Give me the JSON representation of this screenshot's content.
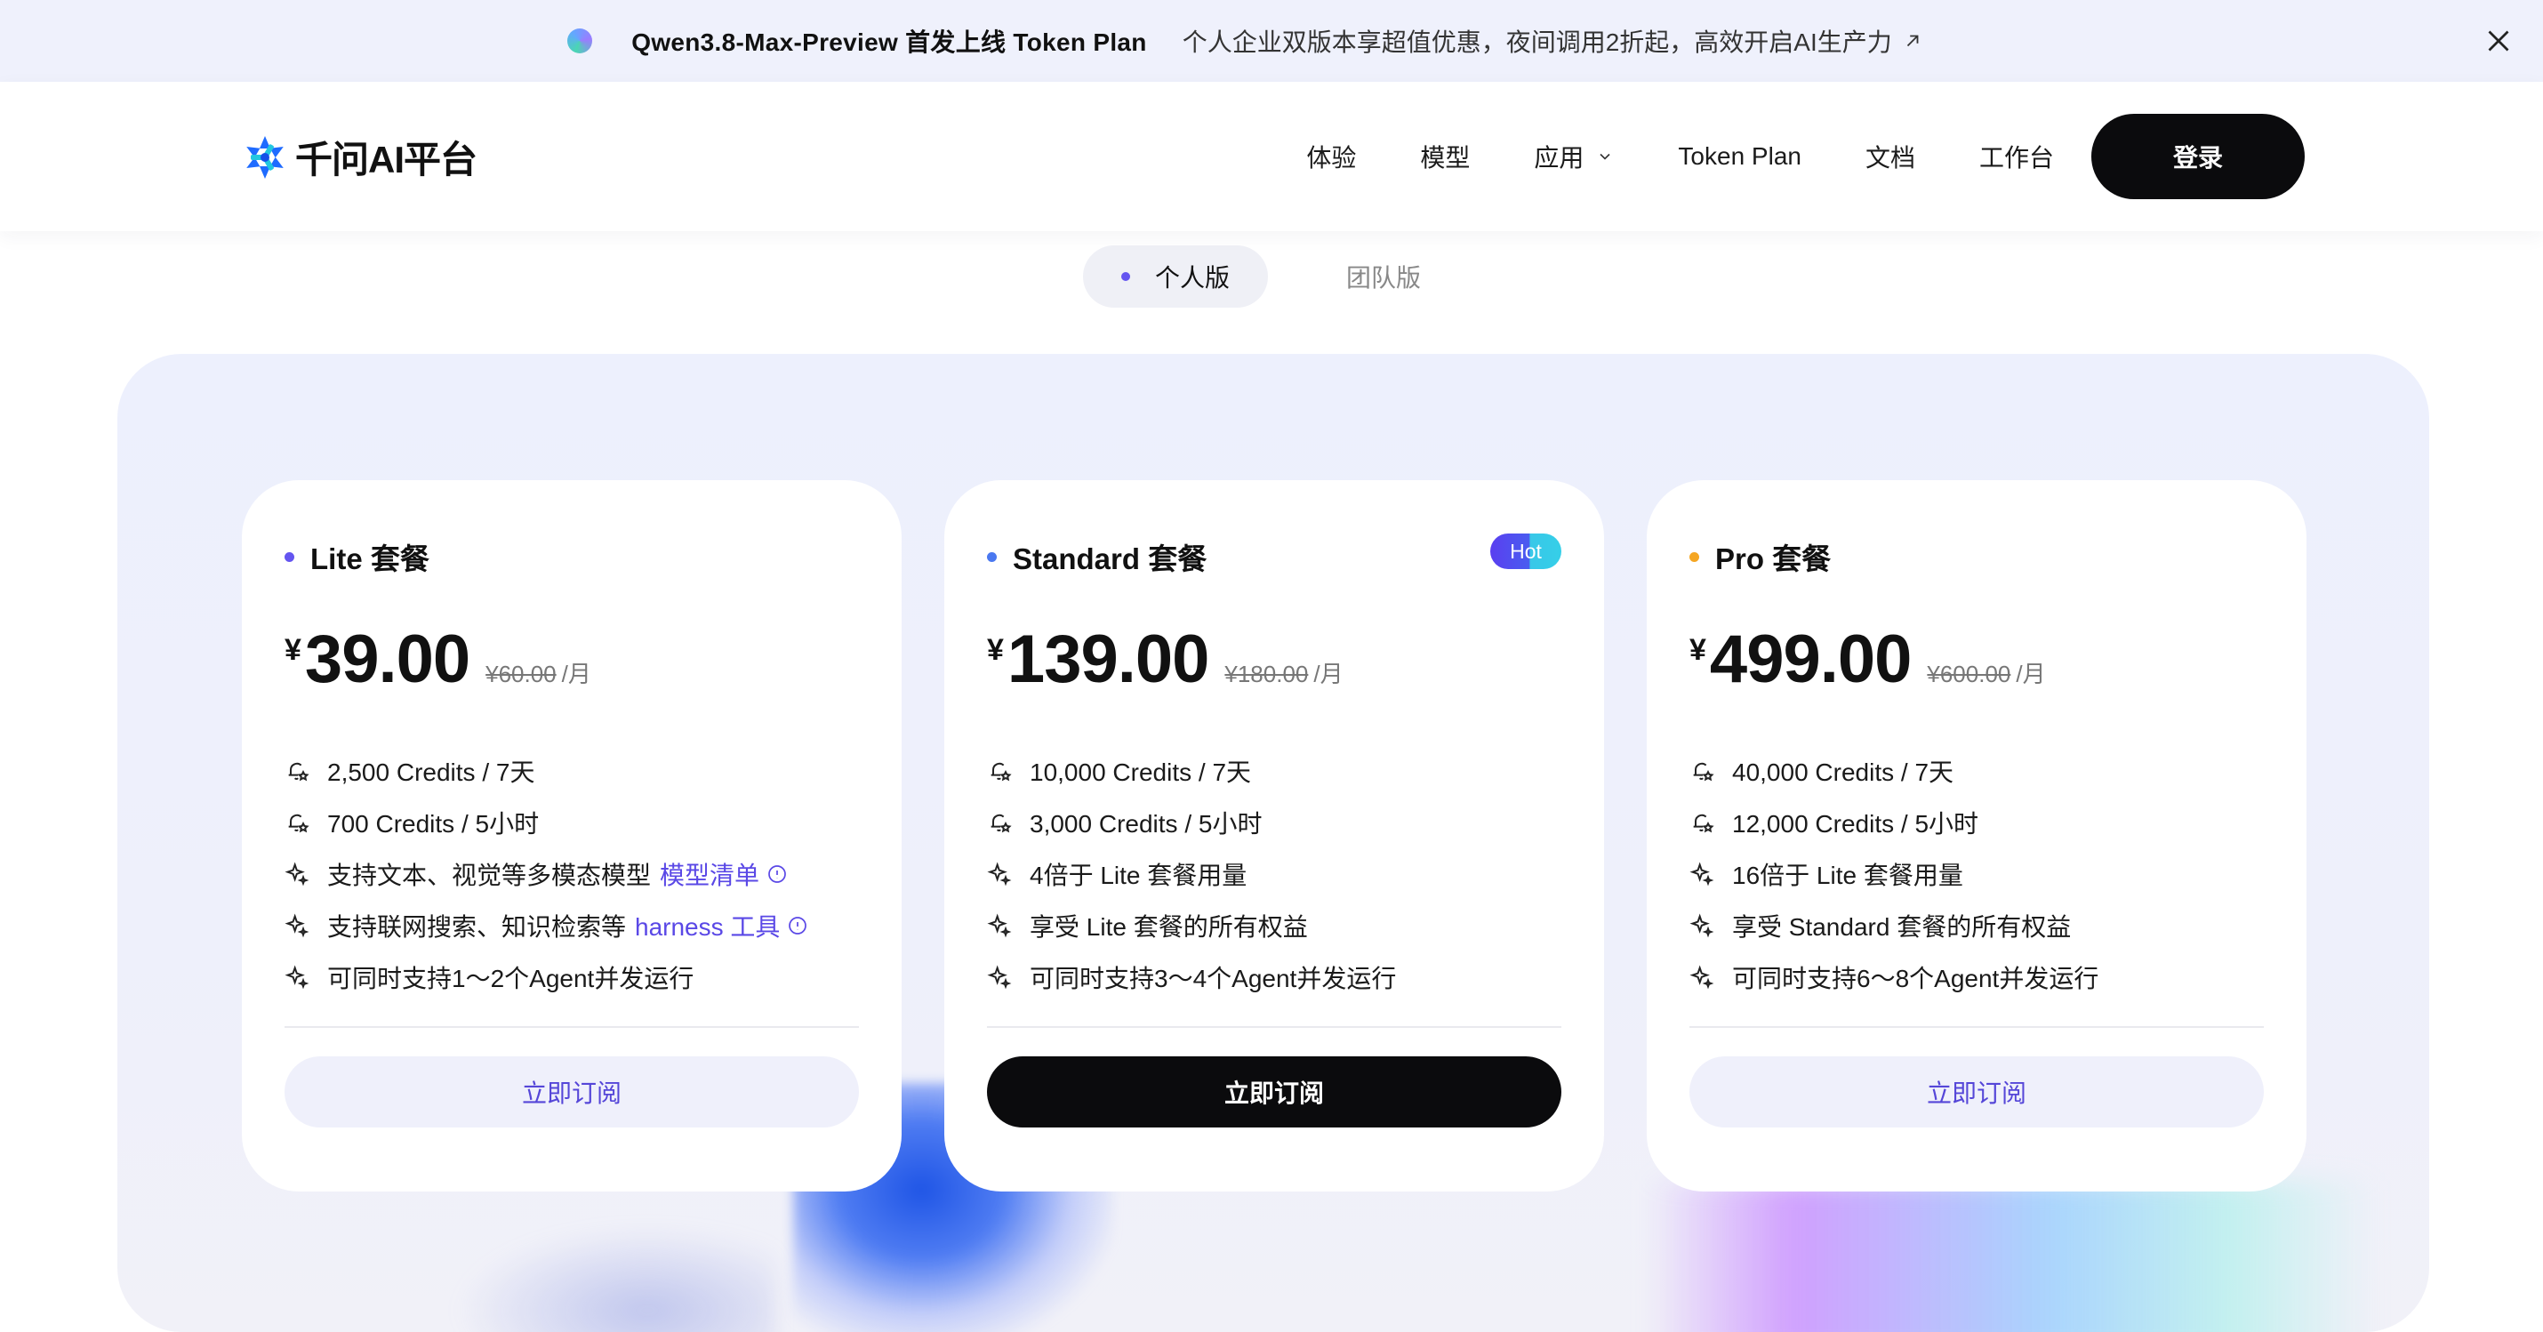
{
  "announcement": {
    "title": "Qwen3.8-Max-Preview 首发上线 Token Plan",
    "description": "个人企业双版本享超值优惠，夜间调用2折起，高效开启AI生产力"
  },
  "header": {
    "logo_text": "千问AI平台",
    "nav": {
      "experience": "体验",
      "models": "模型",
      "apps": "应用",
      "token_plan": "Token Plan",
      "docs": "文档",
      "workbench": "工作台"
    },
    "login_label": "登录"
  },
  "tabs": {
    "personal": "个人版",
    "team": "团队版",
    "active": "个人版"
  },
  "plans": {
    "lite": {
      "name": "Lite 套餐",
      "dot_color": "#6455f0",
      "currency": "¥",
      "price": "39.00",
      "original": "¥60.00",
      "unit": "/月",
      "features": [
        "2,500 Credits / 7天",
        "700 Credits / 5小时",
        "支持文本、视觉等多模态模型",
        "支持联网搜索、知识检索等",
        "可同时支持1～2个Agent并发运行"
      ],
      "links": {
        "model_list": "模型清单",
        "harness": "harness 工具"
      },
      "cta": "立即订阅"
    },
    "standard": {
      "name": "Standard 套餐",
      "dot_color": "#4a78f0",
      "badge": "Hot",
      "currency": "¥",
      "price": "139.00",
      "original": "¥180.00",
      "unit": "/月",
      "features": [
        "10,000 Credits / 7天",
        "3,000 Credits / 5小时",
        "4倍于 Lite 套餐用量",
        "享受 Lite 套餐的所有权益",
        "可同时支持3～4个Agent并发运行"
      ],
      "cta": "立即订阅"
    },
    "pro": {
      "name": "Pro 套餐",
      "dot_color": "#f5a623",
      "currency": "¥",
      "price": "499.00",
      "original": "¥600.00",
      "unit": "/月",
      "features": [
        "40,000 Credits / 7天",
        "12,000 Credits / 5小时",
        "16倍于 Lite 套餐用量",
        "享受 Standard 套餐的所有权益",
        "可同时支持6～8个Agent并发运行"
      ],
      "cta": "立即订阅"
    }
  },
  "colors": {
    "accent": "#5a48e6",
    "dark_button": "#0b0b0d",
    "announce_bg": "#eff1fc"
  }
}
